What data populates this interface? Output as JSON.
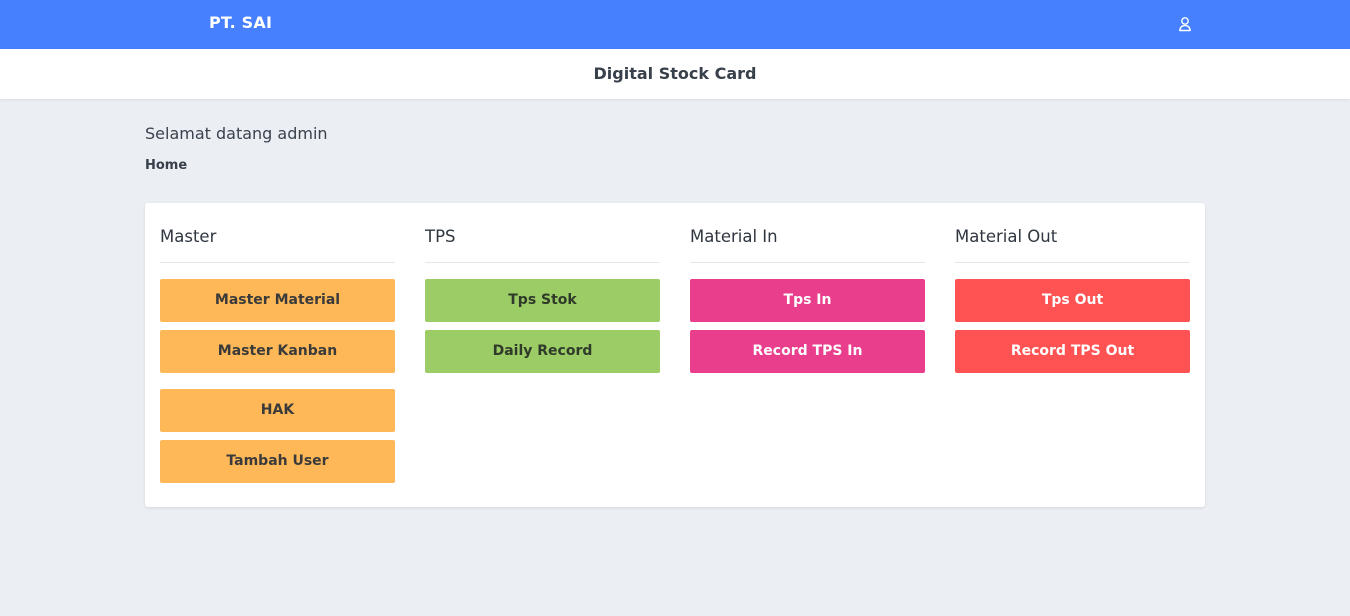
{
  "topbar": {
    "brand": "PT. SAI",
    "user_icon": "user-icon",
    "color": "#4680ff"
  },
  "subbar": {
    "title": "Digital Stock Card"
  },
  "welcome": "Selamat datang admin",
  "breadcrumb": "Home",
  "columns": [
    {
      "title": "Master",
      "color": "#ffb858",
      "buttons": [
        "Master Material",
        "Master Kanban",
        "HAK",
        "Tambah User"
      ]
    },
    {
      "title": "TPS",
      "color": "#9ccc65",
      "buttons": [
        "Tps Stok",
        "Daily Record"
      ]
    },
    {
      "title": "Material In",
      "color": "#e83e8c",
      "buttons": [
        "Tps In",
        "Record TPS In"
      ]
    },
    {
      "title": "Material Out",
      "color": "#ff5252",
      "buttons": [
        "Tps Out",
        "Record TPS Out"
      ]
    }
  ]
}
